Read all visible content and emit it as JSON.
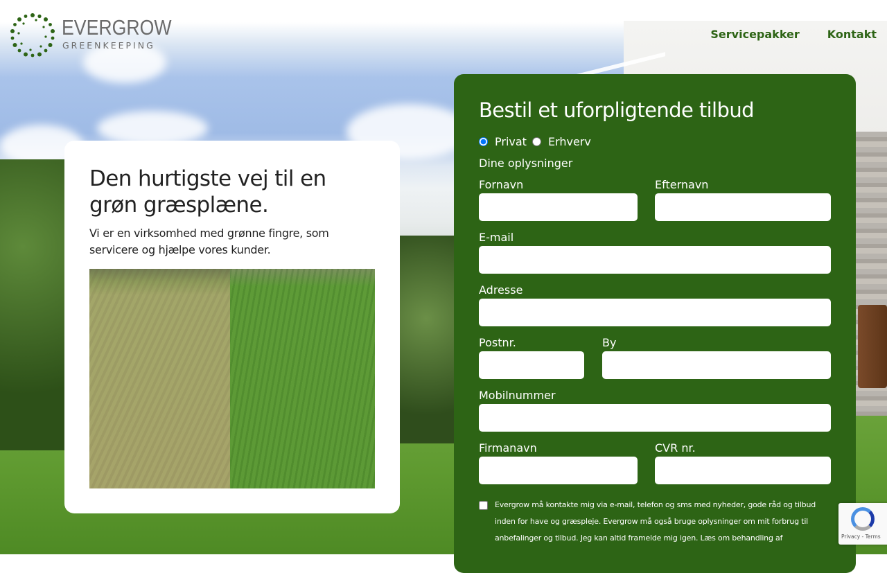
{
  "header": {
    "logo_brand": "EVERGROW",
    "logo_sub": "GREENKEEPING",
    "nav": [
      {
        "label": "Servicepakker"
      },
      {
        "label": "Kontakt"
      }
    ]
  },
  "hero": {
    "title": "Den hurtigste vej til en grøn græsplæne.",
    "text": "Vi er en virksomhed med grønne fingre, som servicere og hjælpe vores kunder."
  },
  "form": {
    "title": "Bestil et uforpligtende tilbud",
    "radio_private": "Privat",
    "radio_business": "Erhverv",
    "section": "Dine oplysninger",
    "first_name": "Fornavn",
    "last_name": "Efternavn",
    "email": "E-mail",
    "address": "Adresse",
    "zip": "Postnr.",
    "city": "By",
    "mobile": "Mobilnummer",
    "company": "Firmanavn",
    "cvr": "CVR nr.",
    "consent": "Evergrow må kontakte mig via e-mail, telefon og sms med nyheder, gode råd og tilbud inden for have og græspleje. Evergrow må også bruge oplysninger om mit forbrug til anbefalinger og tilbud. Jeg kan altid framelde mig igen. Læs om behandling af"
  },
  "recaptcha": {
    "text": "Privacy - Terms"
  },
  "colors": {
    "brand_green": "#2d6415",
    "logo_gray": "#6b6b6b"
  }
}
